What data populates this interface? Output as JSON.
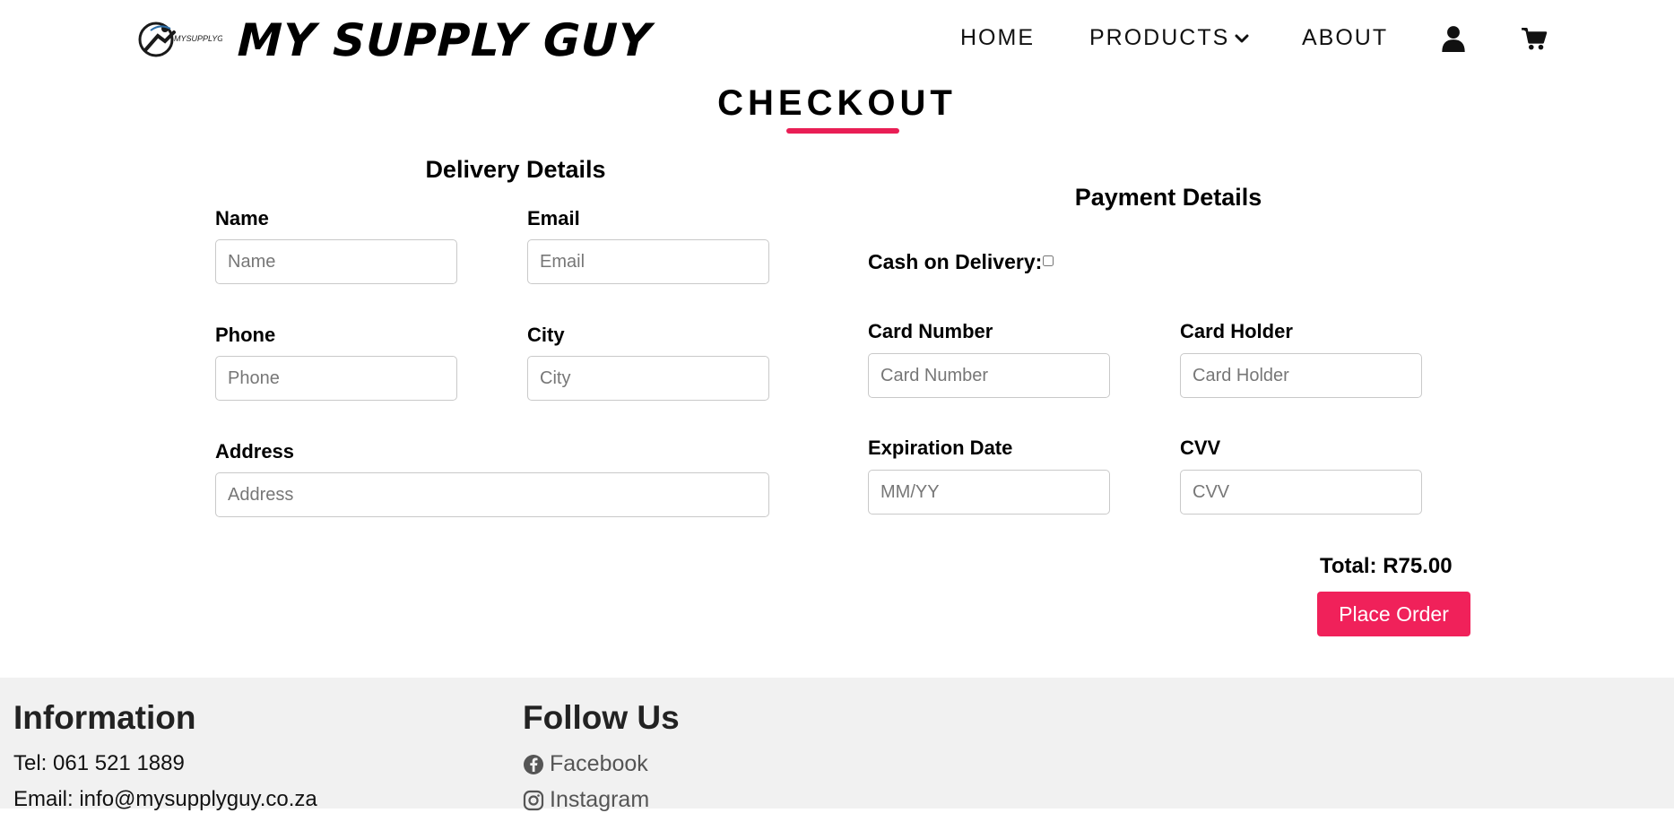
{
  "brand": {
    "logo_small_text": "MYSUPPLYGUY",
    "name": "MY SUPPLY GUY"
  },
  "nav": {
    "home": "HOME",
    "products": "PRODUCTS",
    "about": "ABOUT",
    "icons": {
      "user": "user-icon",
      "cart": "cart-icon",
      "dropdown": "chevron-down-icon"
    }
  },
  "page": {
    "title": "CHECKOUT",
    "accent_color": "#e91e55"
  },
  "delivery": {
    "title": "Delivery Details",
    "fields": {
      "name": {
        "label": "Name",
        "placeholder": "Name"
      },
      "email": {
        "label": "Email",
        "placeholder": "Email"
      },
      "phone": {
        "label": "Phone",
        "placeholder": "Phone"
      },
      "city": {
        "label": "City",
        "placeholder": "City"
      },
      "address": {
        "label": "Address",
        "placeholder": "Address"
      }
    }
  },
  "payment": {
    "title": "Payment Details",
    "cod_label": "Cash on Delivery:",
    "cod_checked": false,
    "fields": {
      "card_number": {
        "label": "Card Number",
        "placeholder": "Card Number"
      },
      "card_holder": {
        "label": "Card Holder",
        "placeholder": "Card Holder"
      },
      "expiration": {
        "label": "Expiration Date",
        "placeholder": "MM/YY"
      },
      "cvv": {
        "label": "CVV",
        "placeholder": "CVV"
      }
    }
  },
  "order": {
    "total": "Total: R75.00",
    "button": "Place Order",
    "button_color": "#f0215a"
  },
  "footer": {
    "info_heading": "Information",
    "tel": "Tel: 061 521 1889",
    "email": "Email: info@mysupplyguy.co.za",
    "follow_heading": "Follow Us",
    "facebook": "Facebook",
    "instagram": "Instagram"
  }
}
